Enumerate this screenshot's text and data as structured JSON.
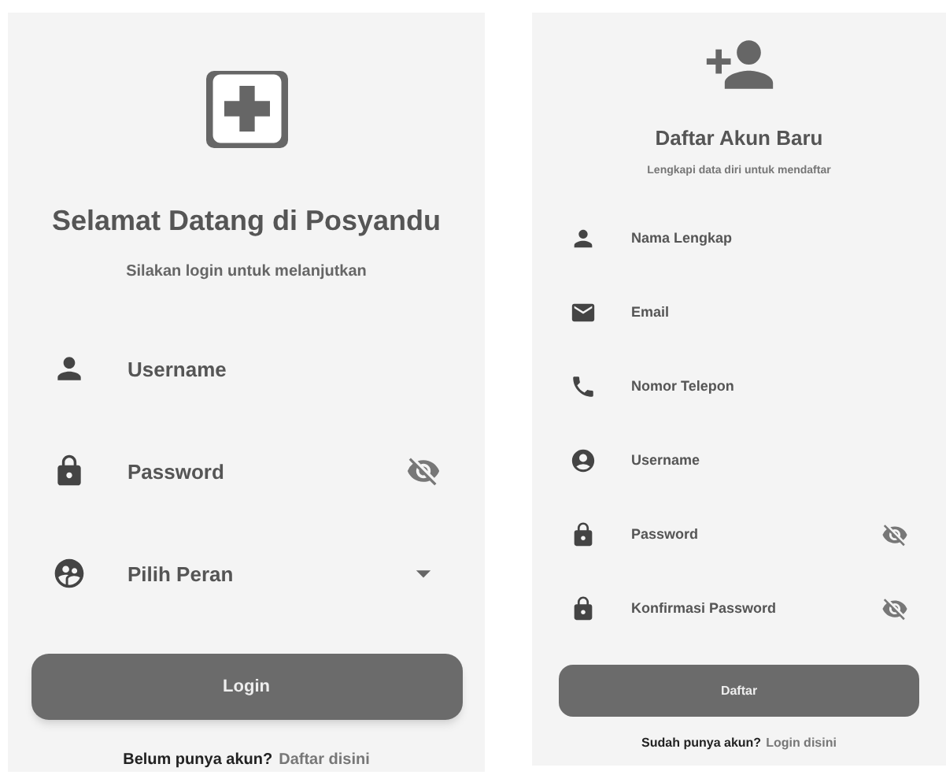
{
  "login": {
    "title": "Selamat Datang di Posyandu",
    "subtitle": "Silakan login untuk melanjutkan",
    "fields": [
      {
        "kind": "text",
        "placeholder": "Username"
      },
      {
        "kind": "password",
        "placeholder": "Password"
      },
      {
        "kind": "select",
        "placeholder": "Pilih Peran"
      }
    ],
    "button": "Login",
    "footer_text": "Belum punya akun?",
    "footer_link": "Daftar disini"
  },
  "register": {
    "title": "Daftar Akun Baru",
    "subtitle": "Lengkapi data diri untuk mendaftar",
    "fields": [
      {
        "kind": "text",
        "placeholder": "Nama Lengkap"
      },
      {
        "kind": "text",
        "placeholder": "Email"
      },
      {
        "kind": "text",
        "placeholder": "Nomor Telepon"
      },
      {
        "kind": "text",
        "placeholder": "Username"
      },
      {
        "kind": "password",
        "placeholder": "Password"
      },
      {
        "kind": "password",
        "placeholder": "Konfirmasi Password"
      }
    ],
    "button": "Daftar",
    "footer_text": "Sudah punya akun?",
    "footer_link": "Login disini"
  }
}
